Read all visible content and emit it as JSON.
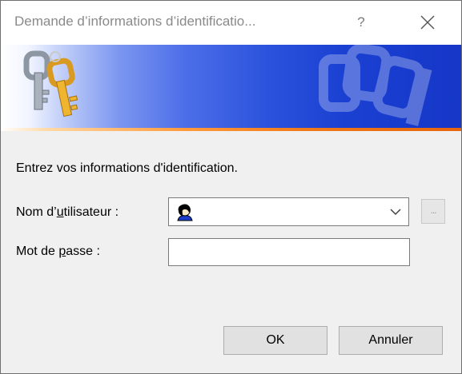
{
  "window": {
    "title": "Demande d’informations d’identificatio...",
    "help_glyph": "?",
    "close_icon": "close-icon"
  },
  "banner": {
    "icon": "keys-icon",
    "watermark": "keys-watermark",
    "gradient_start": "#ffffff",
    "gradient_end": "#1637c8",
    "accent_color": "#f07b1a"
  },
  "form": {
    "prompt": "Entrez vos informations d'identification.",
    "username": {
      "label_before": "Nom d’",
      "label_accel": "u",
      "label_after": "tilisateur :",
      "value": "",
      "icon": "user-icon",
      "dropdown_icon": "chevron-down-icon",
      "browse_label": "..."
    },
    "password": {
      "label_before": "Mot de ",
      "label_accel": "p",
      "label_after": "asse :",
      "value": ""
    }
  },
  "buttons": {
    "ok": "OK",
    "cancel": "Annuler"
  }
}
